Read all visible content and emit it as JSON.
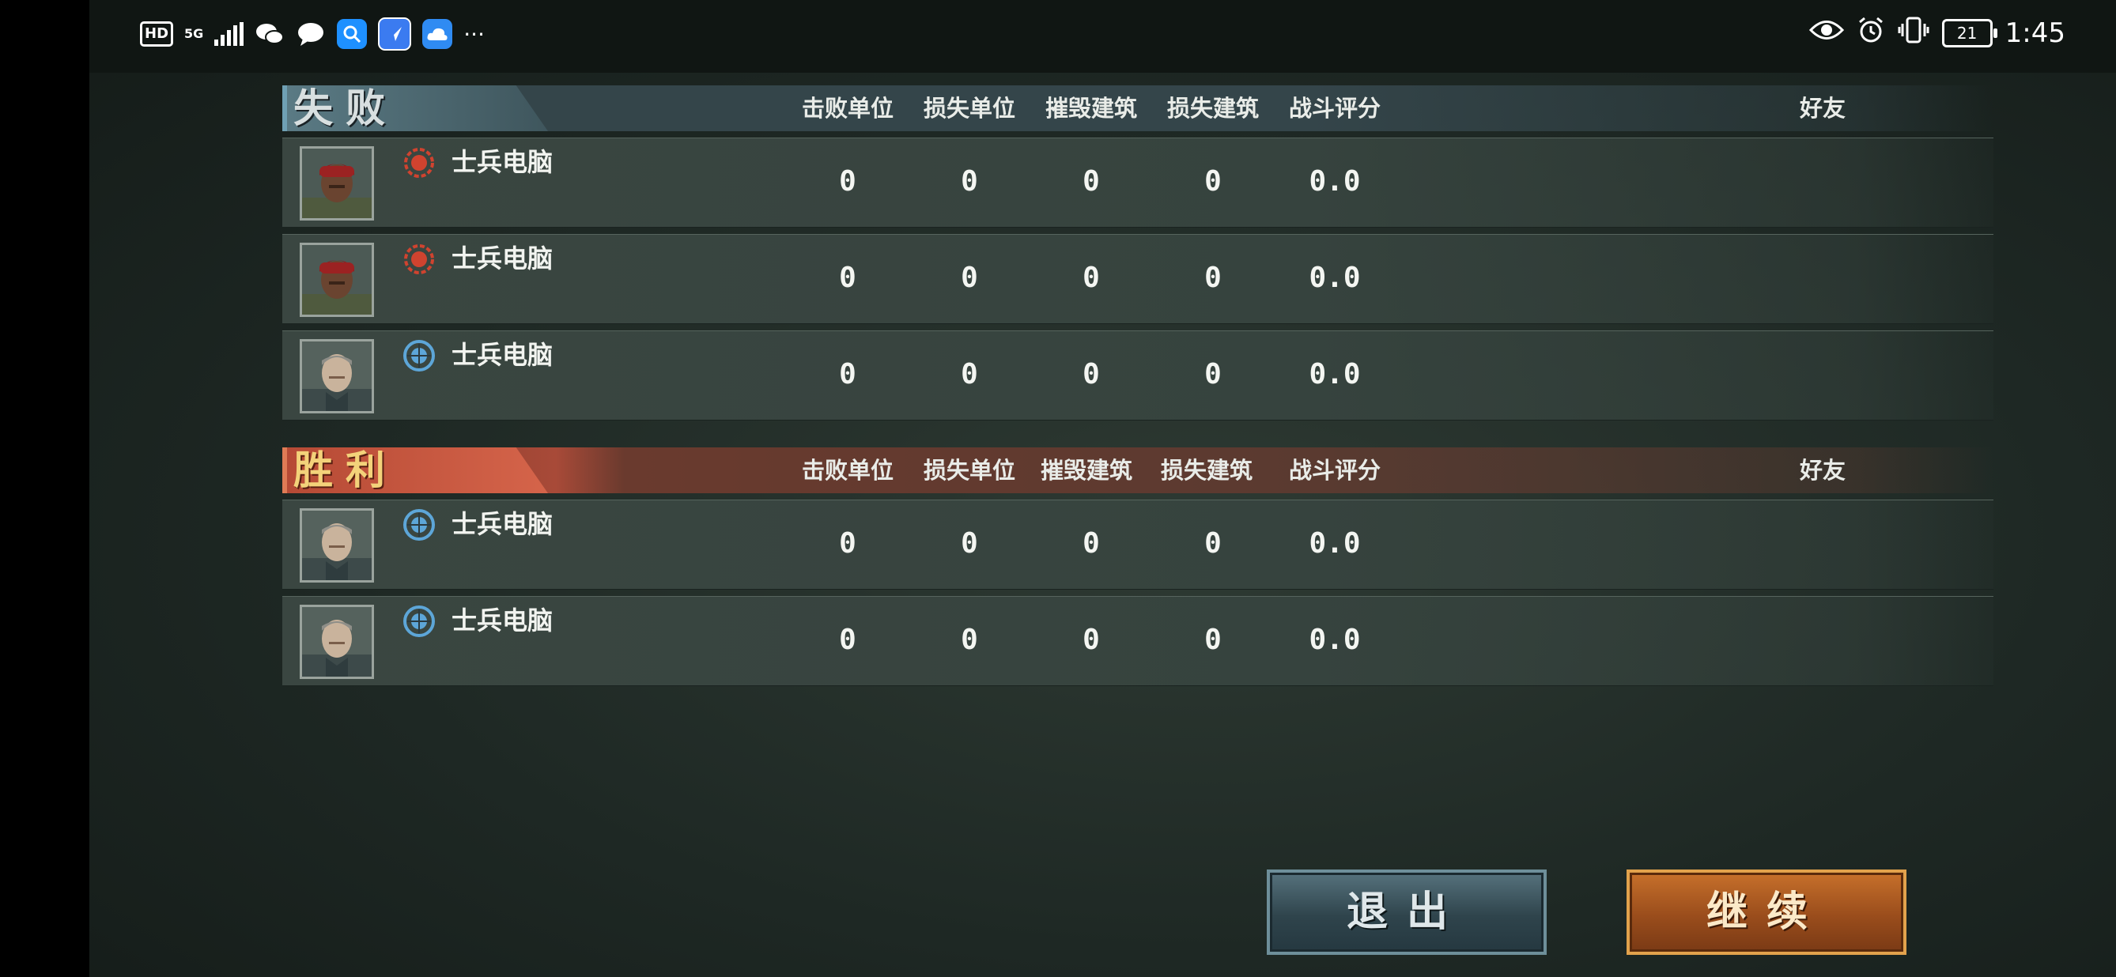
{
  "status_bar": {
    "hd": "HD",
    "network": "5G",
    "more": "···",
    "battery": "21",
    "time": "1:45",
    "icons": [
      "wechat-icon",
      "message-icon",
      "search-app-icon",
      "browser-app-icon",
      "cloud-app-icon",
      "eye-icon",
      "alarm-icon",
      "vibrate-icon"
    ]
  },
  "columns": [
    "击败单位",
    "损失单位",
    "摧毁建筑",
    "损失建筑",
    "战斗评分"
  ],
  "friend_label": "好友",
  "defeat": {
    "title": "失败",
    "rows": [
      {
        "name": "士兵电脑",
        "faction": "red",
        "stats": [
          "0",
          "0",
          "0",
          "0",
          "0.0"
        ]
      },
      {
        "name": "士兵电脑",
        "faction": "red",
        "stats": [
          "0",
          "0",
          "0",
          "0",
          "0.0"
        ]
      },
      {
        "name": "士兵电脑",
        "faction": "blue",
        "stats": [
          "0",
          "0",
          "0",
          "0",
          "0.0"
        ]
      }
    ]
  },
  "victory": {
    "title": "胜利",
    "rows": [
      {
        "name": "士兵电脑",
        "faction": "blue",
        "stats": [
          "0",
          "0",
          "0",
          "0",
          "0.0"
        ]
      },
      {
        "name": "士兵电脑",
        "faction": "blue",
        "stats": [
          "0",
          "0",
          "0",
          "0",
          "0.0"
        ]
      }
    ]
  },
  "buttons": {
    "exit": "退出",
    "continue": "继续"
  }
}
